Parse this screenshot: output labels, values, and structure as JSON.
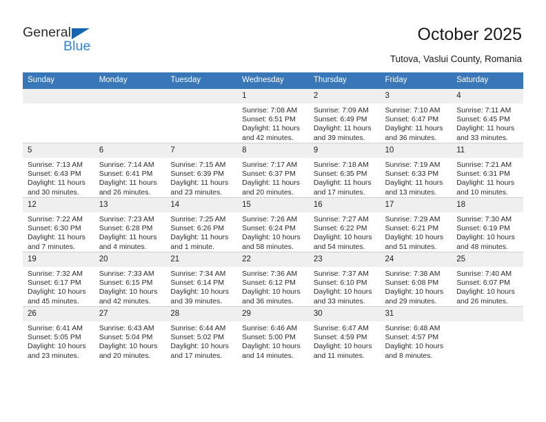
{
  "brand": {
    "name_part1": "General",
    "name_part2": "Blue",
    "colors": {
      "dark": "#2b2b2b",
      "blue": "#2f84d6",
      "triangle": "#1665b0"
    }
  },
  "header": {
    "title": "October 2025",
    "subtitle": "Tutova, Vaslui County, Romania",
    "accent_color": "#3a77b8",
    "daynum_bg": "#efefef"
  },
  "calendar": {
    "weekday_headers": [
      "Sunday",
      "Monday",
      "Tuesday",
      "Wednesday",
      "Thursday",
      "Friday",
      "Saturday"
    ],
    "weeks": [
      [
        {
          "day": "",
          "blank": true
        },
        {
          "day": "",
          "blank": true
        },
        {
          "day": "",
          "blank": true
        },
        {
          "day": "1",
          "sunrise": "Sunrise: 7:08 AM",
          "sunset": "Sunset: 6:51 PM",
          "daylight": "Daylight: 11 hours and 42 minutes."
        },
        {
          "day": "2",
          "sunrise": "Sunrise: 7:09 AM",
          "sunset": "Sunset: 6:49 PM",
          "daylight": "Daylight: 11 hours and 39 minutes."
        },
        {
          "day": "3",
          "sunrise": "Sunrise: 7:10 AM",
          "sunset": "Sunset: 6:47 PM",
          "daylight": "Daylight: 11 hours and 36 minutes."
        },
        {
          "day": "4",
          "sunrise": "Sunrise: 7:11 AM",
          "sunset": "Sunset: 6:45 PM",
          "daylight": "Daylight: 11 hours and 33 minutes."
        }
      ],
      [
        {
          "day": "5",
          "sunrise": "Sunrise: 7:13 AM",
          "sunset": "Sunset: 6:43 PM",
          "daylight": "Daylight: 11 hours and 30 minutes."
        },
        {
          "day": "6",
          "sunrise": "Sunrise: 7:14 AM",
          "sunset": "Sunset: 6:41 PM",
          "daylight": "Daylight: 11 hours and 26 minutes."
        },
        {
          "day": "7",
          "sunrise": "Sunrise: 7:15 AM",
          "sunset": "Sunset: 6:39 PM",
          "daylight": "Daylight: 11 hours and 23 minutes."
        },
        {
          "day": "8",
          "sunrise": "Sunrise: 7:17 AM",
          "sunset": "Sunset: 6:37 PM",
          "daylight": "Daylight: 11 hours and 20 minutes."
        },
        {
          "day": "9",
          "sunrise": "Sunrise: 7:18 AM",
          "sunset": "Sunset: 6:35 PM",
          "daylight": "Daylight: 11 hours and 17 minutes."
        },
        {
          "day": "10",
          "sunrise": "Sunrise: 7:19 AM",
          "sunset": "Sunset: 6:33 PM",
          "daylight": "Daylight: 11 hours and 13 minutes."
        },
        {
          "day": "11",
          "sunrise": "Sunrise: 7:21 AM",
          "sunset": "Sunset: 6:31 PM",
          "daylight": "Daylight: 11 hours and 10 minutes."
        }
      ],
      [
        {
          "day": "12",
          "sunrise": "Sunrise: 7:22 AM",
          "sunset": "Sunset: 6:30 PM",
          "daylight": "Daylight: 11 hours and 7 minutes."
        },
        {
          "day": "13",
          "sunrise": "Sunrise: 7:23 AM",
          "sunset": "Sunset: 6:28 PM",
          "daylight": "Daylight: 11 hours and 4 minutes."
        },
        {
          "day": "14",
          "sunrise": "Sunrise: 7:25 AM",
          "sunset": "Sunset: 6:26 PM",
          "daylight": "Daylight: 11 hours and 1 minute."
        },
        {
          "day": "15",
          "sunrise": "Sunrise: 7:26 AM",
          "sunset": "Sunset: 6:24 PM",
          "daylight": "Daylight: 10 hours and 58 minutes."
        },
        {
          "day": "16",
          "sunrise": "Sunrise: 7:27 AM",
          "sunset": "Sunset: 6:22 PM",
          "daylight": "Daylight: 10 hours and 54 minutes."
        },
        {
          "day": "17",
          "sunrise": "Sunrise: 7:29 AM",
          "sunset": "Sunset: 6:21 PM",
          "daylight": "Daylight: 10 hours and 51 minutes."
        },
        {
          "day": "18",
          "sunrise": "Sunrise: 7:30 AM",
          "sunset": "Sunset: 6:19 PM",
          "daylight": "Daylight: 10 hours and 48 minutes."
        }
      ],
      [
        {
          "day": "19",
          "sunrise": "Sunrise: 7:32 AM",
          "sunset": "Sunset: 6:17 PM",
          "daylight": "Daylight: 10 hours and 45 minutes."
        },
        {
          "day": "20",
          "sunrise": "Sunrise: 7:33 AM",
          "sunset": "Sunset: 6:15 PM",
          "daylight": "Daylight: 10 hours and 42 minutes."
        },
        {
          "day": "21",
          "sunrise": "Sunrise: 7:34 AM",
          "sunset": "Sunset: 6:14 PM",
          "daylight": "Daylight: 10 hours and 39 minutes."
        },
        {
          "day": "22",
          "sunrise": "Sunrise: 7:36 AM",
          "sunset": "Sunset: 6:12 PM",
          "daylight": "Daylight: 10 hours and 36 minutes."
        },
        {
          "day": "23",
          "sunrise": "Sunrise: 7:37 AM",
          "sunset": "Sunset: 6:10 PM",
          "daylight": "Daylight: 10 hours and 33 minutes."
        },
        {
          "day": "24",
          "sunrise": "Sunrise: 7:38 AM",
          "sunset": "Sunset: 6:08 PM",
          "daylight": "Daylight: 10 hours and 29 minutes."
        },
        {
          "day": "25",
          "sunrise": "Sunrise: 7:40 AM",
          "sunset": "Sunset: 6:07 PM",
          "daylight": "Daylight: 10 hours and 26 minutes."
        }
      ],
      [
        {
          "day": "26",
          "sunrise": "Sunrise: 6:41 AM",
          "sunset": "Sunset: 5:05 PM",
          "daylight": "Daylight: 10 hours and 23 minutes."
        },
        {
          "day": "27",
          "sunrise": "Sunrise: 6:43 AM",
          "sunset": "Sunset: 5:04 PM",
          "daylight": "Daylight: 10 hours and 20 minutes."
        },
        {
          "day": "28",
          "sunrise": "Sunrise: 6:44 AM",
          "sunset": "Sunset: 5:02 PM",
          "daylight": "Daylight: 10 hours and 17 minutes."
        },
        {
          "day": "29",
          "sunrise": "Sunrise: 6:46 AM",
          "sunset": "Sunset: 5:00 PM",
          "daylight": "Daylight: 10 hours and 14 minutes."
        },
        {
          "day": "30",
          "sunrise": "Sunrise: 6:47 AM",
          "sunset": "Sunset: 4:59 PM",
          "daylight": "Daylight: 10 hours and 11 minutes."
        },
        {
          "day": "31",
          "sunrise": "Sunrise: 6:48 AM",
          "sunset": "Sunset: 4:57 PM",
          "daylight": "Daylight: 10 hours and 8 minutes."
        },
        {
          "day": "",
          "blank": true
        }
      ]
    ]
  }
}
